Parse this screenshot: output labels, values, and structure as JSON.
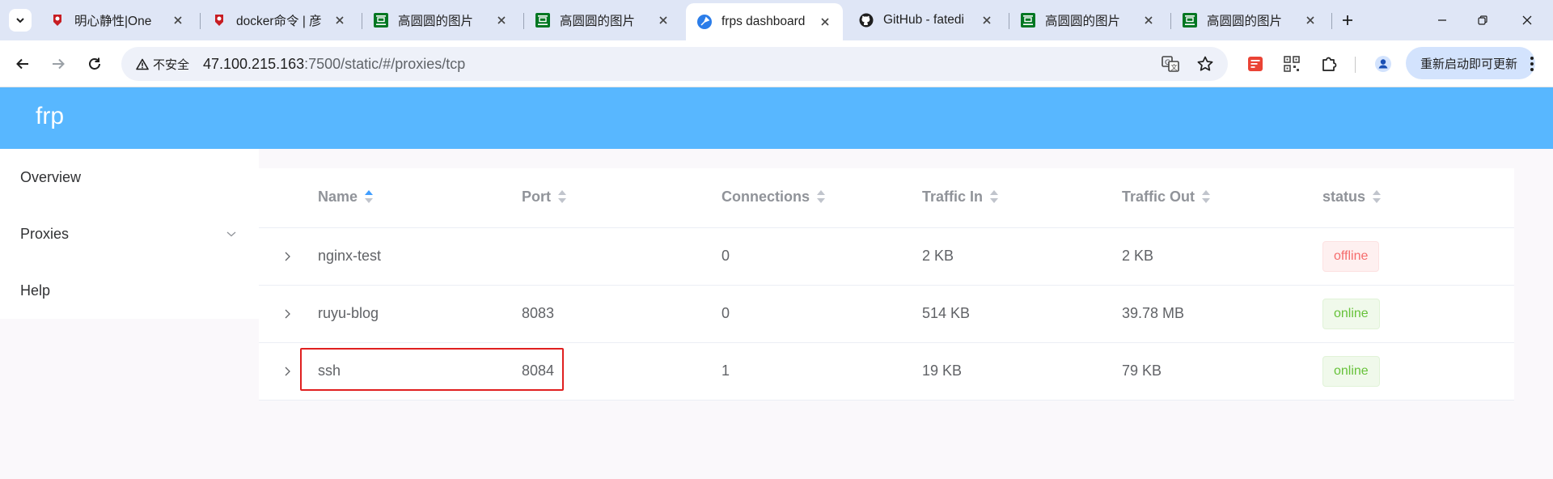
{
  "browser": {
    "tabs": [
      {
        "title": "明心静性|One",
        "icon": "gitee-icon",
        "active": false
      },
      {
        "title": "docker命令 | 彦",
        "icon": "gitee-icon",
        "active": false
      },
      {
        "title": "高圆圆的图片",
        "icon": "douban-icon",
        "active": false
      },
      {
        "title": "高圆圆的图片",
        "icon": "douban-icon",
        "active": false
      },
      {
        "title": "frps dashboard",
        "icon": "frp-icon",
        "active": true
      },
      {
        "title": "GitHub - fatedi",
        "icon": "github-icon",
        "active": false
      },
      {
        "title": "高圆圆的图片",
        "icon": "douban-icon",
        "active": false
      },
      {
        "title": "高圆圆的图片",
        "icon": "douban-icon",
        "active": false
      }
    ],
    "security_label": "不安全",
    "url_host": "47.100.215.163",
    "url_rest": ":7500/static/#/proxies/tcp",
    "update_label": "重新启动即可更新"
  },
  "app": {
    "brand": "frp",
    "header_color": "#58b7ff"
  },
  "sidebar": {
    "items": [
      {
        "label": "Overview"
      },
      {
        "label": "Proxies",
        "has_submenu": true
      },
      {
        "label": "Help"
      }
    ]
  },
  "table": {
    "columns": [
      "Name",
      "Port",
      "Connections",
      "Traffic In",
      "Traffic Out",
      "status"
    ],
    "sorted_column": "Name",
    "rows": [
      {
        "name": "nginx-test",
        "port": "",
        "connections": "0",
        "traffic_in": "2 KB",
        "traffic_out": "2 KB",
        "status": "offline"
      },
      {
        "name": "ruyu-blog",
        "port": "8083",
        "connections": "0",
        "traffic_in": "514 KB",
        "traffic_out": "39.78 MB",
        "status": "online"
      },
      {
        "name": "ssh",
        "port": "8084",
        "connections": "1",
        "traffic_in": "19 KB",
        "traffic_out": "79 KB",
        "status": "online",
        "highlighted": true
      }
    ]
  },
  "colors": {
    "offline": "#f56c6c",
    "online": "#67c23a",
    "highlight": "#e02020"
  }
}
